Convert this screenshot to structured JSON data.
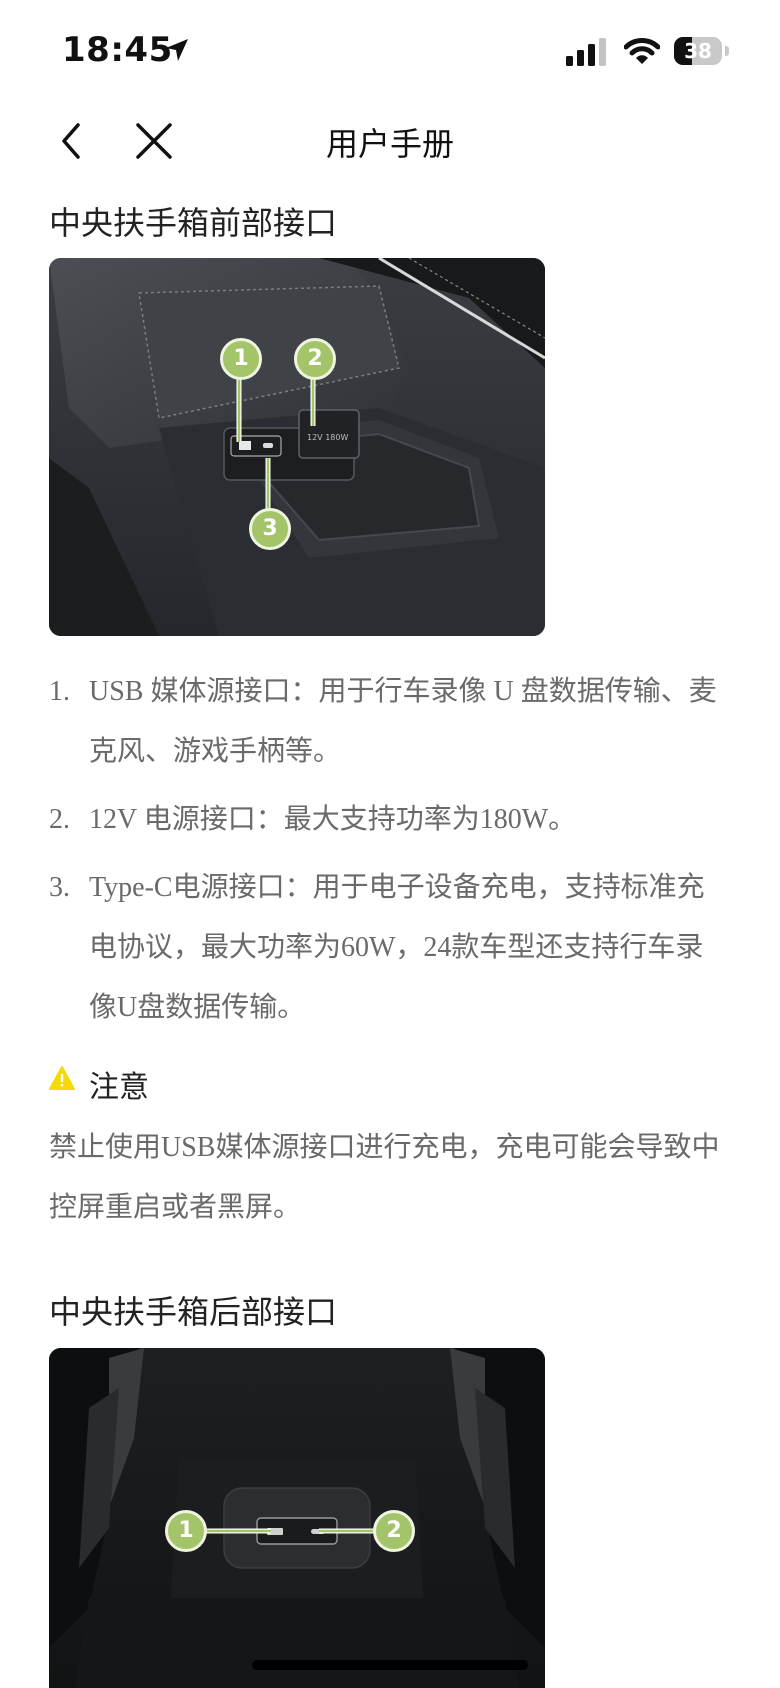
{
  "status_bar": {
    "time": "18:45",
    "battery_level": "38",
    "icons": [
      "location-arrow-icon",
      "cellular-signal-icon",
      "wifi-icon",
      "battery-icon"
    ]
  },
  "nav": {
    "title": "用户手册",
    "back_icon": "chevron-left-icon",
    "close_icon": "close-icon"
  },
  "front_section": {
    "title": "中央扶手箱前部接口",
    "callouts": [
      "1",
      "2",
      "3"
    ],
    "items": [
      {
        "num": "1.",
        "text": "USB 媒体源接口：用于行车录像 U 盘数据传输、麦克风、游戏手柄等。"
      },
      {
        "num": "2.",
        "text": "12V 电源接口：最大支持功率为180W。"
      },
      {
        "num": "3.",
        "text": "Type-C电源接口：用于电子设备充电，支持标准充电协议，最大功率为60W，24款车型还支持行车录像U盘数据传输。"
      }
    ]
  },
  "note": {
    "icon": "warning-icon",
    "label": "注意",
    "text": "禁止使用USB媒体源接口进行充电，充电可能会导致中控屏重启或者黑屏。"
  },
  "rear_section": {
    "title": "中央扶手箱后部接口",
    "callouts": [
      "1",
      "2"
    ]
  },
  "colors": {
    "callout_green": "#a4c46a",
    "warning_yellow": "#f5d90a",
    "body_text": "#6a6a6a"
  }
}
